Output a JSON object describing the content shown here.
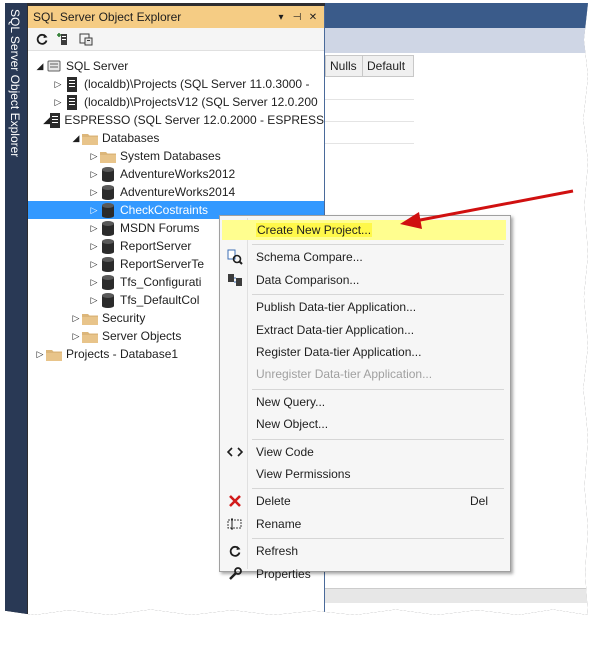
{
  "window": {
    "vertical_tab_label": "SQL Server Object Explorer"
  },
  "panel": {
    "title": "SQL Server Object Explorer",
    "pin_glyph": "▾",
    "dock_glyph": "⊣",
    "close_glyph": "✕",
    "toolbar": [
      "refresh-icon",
      "add-server-icon",
      "filter-icon"
    ]
  },
  "tree": [
    {
      "label": "SQL Server",
      "icon": "server-root-icon",
      "expanded": true
    },
    {
      "label": "(localdb)\\Projects (SQL Server 11.0.3000 -",
      "icon": "server-icon"
    },
    {
      "label": "(localdb)\\ProjectsV12 (SQL Server 12.0.200",
      "icon": "server-icon"
    },
    {
      "label": "ESPRESSO (SQL Server 12.0.2000 - ESPRESS",
      "icon": "server-icon",
      "expanded": true
    },
    {
      "label": "Databases",
      "icon": "folder-icon",
      "expanded": true
    },
    {
      "label": "System Databases",
      "icon": "folder-icon"
    },
    {
      "label": "AdventureWorks2012",
      "icon": "database-icon"
    },
    {
      "label": "AdventureWorks2014",
      "icon": "database-icon"
    },
    {
      "label": "CheckCostraints",
      "icon": "database-icon",
      "selected": true
    },
    {
      "label": "MSDN Forums",
      "icon": "database-icon"
    },
    {
      "label": "ReportServer",
      "icon": "database-icon"
    },
    {
      "label": "ReportServerTe",
      "icon": "database-icon"
    },
    {
      "label": "Tfs_Configurati",
      "icon": "database-icon"
    },
    {
      "label": "Tfs_DefaultCol",
      "icon": "database-icon"
    },
    {
      "label": "Security",
      "icon": "folder-icon"
    },
    {
      "label": "Server Objects",
      "icon": "folder-icon"
    },
    {
      "label": "Projects - Database1",
      "icon": "folder-icon"
    }
  ],
  "grid": {
    "columns": [
      "Nulls",
      "Default"
    ]
  },
  "context_menu": [
    {
      "label": "Create New Project...",
      "icon": "",
      "highlighted": true
    },
    {
      "separator": true
    },
    {
      "label": "Schema Compare...",
      "icon": "schema-compare-icon"
    },
    {
      "label": "Data Comparison...",
      "icon": "data-compare-icon"
    },
    {
      "separator": true
    },
    {
      "label": "Publish Data-tier Application...",
      "icon": ""
    },
    {
      "label": "Extract Data-tier Application...",
      "icon": ""
    },
    {
      "label": "Register Data-tier Application...",
      "icon": ""
    },
    {
      "label": "Unregister Data-tier Application...",
      "icon": "",
      "disabled": true
    },
    {
      "separator": true
    },
    {
      "label": "New Query...",
      "icon": ""
    },
    {
      "label": "New Object...",
      "icon": ""
    },
    {
      "separator": true
    },
    {
      "label": "View Code",
      "icon": "code-icon"
    },
    {
      "label": "View Permissions",
      "icon": ""
    },
    {
      "separator": true
    },
    {
      "label": "Delete",
      "icon": "delete-icon",
      "shortcut": "Del"
    },
    {
      "label": "Rename",
      "icon": "rename-icon"
    },
    {
      "separator": true
    },
    {
      "label": "Refresh",
      "icon": "refresh-icon"
    },
    {
      "label": "Properties",
      "icon": "wrench-icon"
    }
  ],
  "colors": {
    "panel_header": "#f5cc84",
    "selection": "#3399ff",
    "highlight": "#fff84a",
    "arrow": "#d01010",
    "tab_strip": "#293955"
  }
}
